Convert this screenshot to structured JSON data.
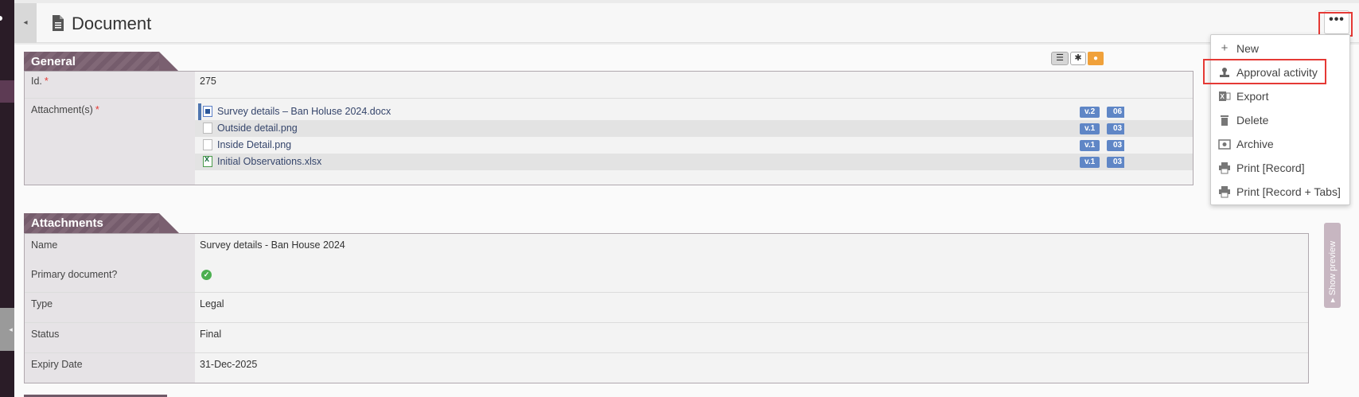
{
  "header": {
    "title": "Document",
    "more_label": "•••"
  },
  "general": {
    "section_title": "General",
    "id_label": "Id.",
    "id_value": "275",
    "attachments_label": "Attachment(s)",
    "files": [
      {
        "name": "Survey details – Ban Holuse 2024.docx",
        "version": "v.2",
        "date": "06",
        "icon": "word-file-icon"
      },
      {
        "name": "Outside detail.png",
        "version": "v.1",
        "date": "03",
        "icon": "blank-file-icon"
      },
      {
        "name": "Inside Detail.png",
        "version": "v.1",
        "date": "03",
        "icon": "blank-file-icon"
      },
      {
        "name": "Initial Observations.xlsx",
        "version": "v.1",
        "date": "03",
        "icon": "excel-file-icon"
      }
    ],
    "required_mark": "*"
  },
  "attachments_section": {
    "section_title": "Attachments",
    "fields": [
      {
        "label": "Name",
        "value": "Survey details - Ban House 2024"
      },
      {
        "label": "Primary document?",
        "value": ""
      },
      {
        "label": "Type",
        "value": "Legal"
      },
      {
        "label": "Status",
        "value": "Final"
      },
      {
        "label": "Expiry Date",
        "value": "31-Dec-2025"
      }
    ]
  },
  "preview": {
    "label": "▸ Show preview"
  },
  "menu": {
    "items": [
      {
        "label": "New",
        "icon": "plus-icon"
      },
      {
        "label": "Approval activity",
        "icon": "stamp-icon"
      },
      {
        "label": "Export",
        "icon": "excel-export-icon"
      },
      {
        "label": "Delete",
        "icon": "trash-icon"
      },
      {
        "label": "Archive",
        "icon": "archive-icon"
      },
      {
        "label": "Print [Record]",
        "icon": "printer-icon"
      },
      {
        "label": "Print [Record + Tabs]",
        "icon": "printer-icon"
      }
    ]
  },
  "colors": {
    "section_header": "#7a6070",
    "version_badge": "#5f86c6",
    "highlight_box": "#e53935"
  }
}
